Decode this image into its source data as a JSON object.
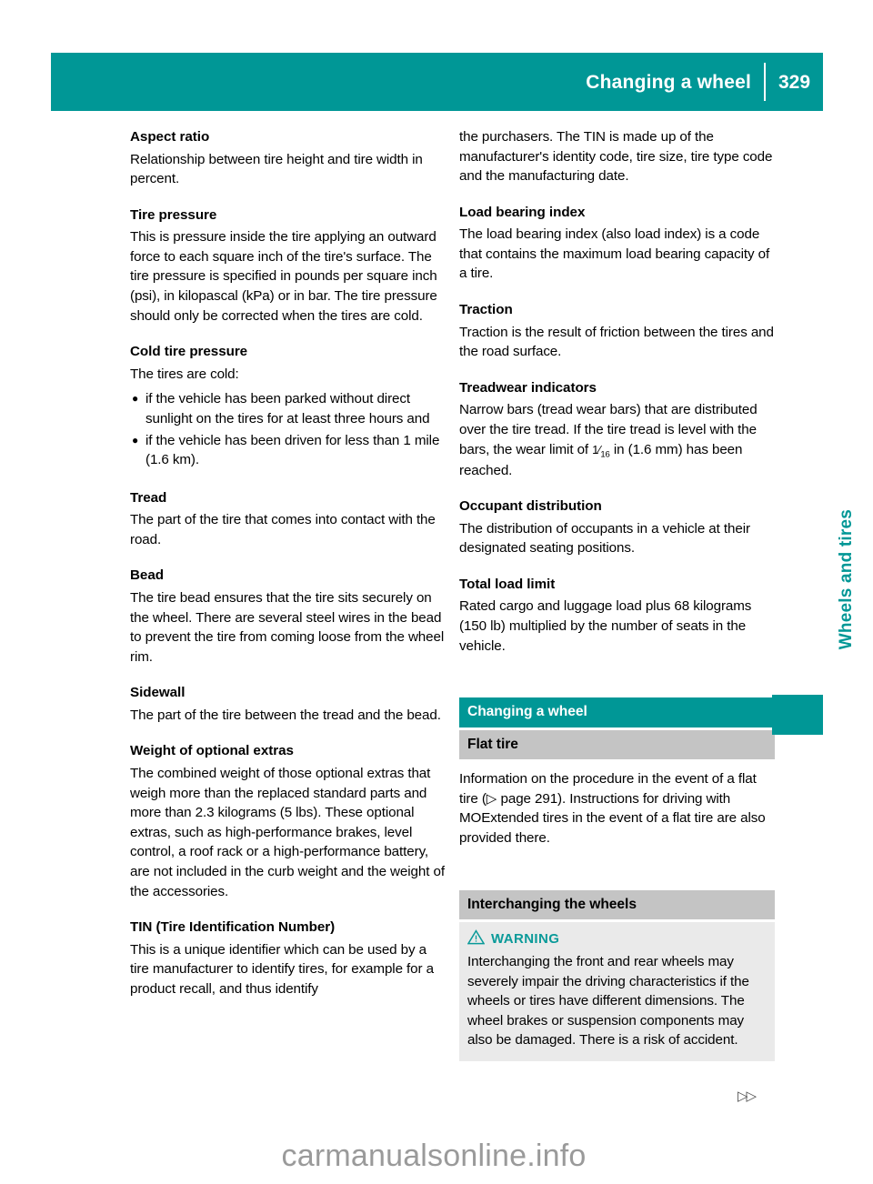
{
  "header": {
    "title": "Changing a wheel",
    "page_number": "329"
  },
  "side_tab": {
    "label": "Wheels and tires"
  },
  "footer": {
    "continue_marker": "▷▷",
    "watermark": "carmanualsonline.info"
  },
  "left_column": {
    "aspect_ratio": {
      "heading": "Aspect ratio",
      "body": "Relationship between tire height and tire width in percent."
    },
    "tire_pressure": {
      "heading": "Tire pressure",
      "body": "This is pressure inside the tire applying an outward force to each square inch of the tire's surface. The tire pressure is specified in pounds per square inch (psi), in kilopascal (kPa) or in bar. The tire pressure should only be corrected when the tires are cold."
    },
    "cold_tire_pressure": {
      "heading": "Cold tire pressure",
      "body": "The tires are cold:",
      "bullet_glyph": "●",
      "bullets": [
        "if the vehicle has been parked without direct sunlight on the tires for at least three hours and",
        "if the vehicle has been driven for less than 1 mile (1.6 km)."
      ]
    },
    "tread": {
      "heading": "Tread",
      "body": "The part of the tire that comes into contact with the road."
    },
    "bead": {
      "heading": "Bead",
      "body": "The tire bead ensures that the tire sits securely on the wheel. There are several steel wires in the bead to prevent the tire from coming loose from the wheel rim."
    },
    "sidewall": {
      "heading": "Sidewall",
      "body": "The part of the tire between the tread and the bead."
    },
    "weight_of_optional_extras": {
      "heading": "Weight of optional extras",
      "body": "The combined weight of those optional extras that weigh more than the replaced standard parts and more than 2.3 kilograms (5 lbs). These optional extras, such as high-performance brakes, level control, a roof rack or a high-performance battery, are not included in the curb weight and the weight of the accessories."
    },
    "tin": {
      "heading": "TIN (Tire Identification Number)",
      "body": "This is a unique identifier which can be used by a tire manufacturer to identify tires, for example for a product recall, and thus identify"
    }
  },
  "right_column": {
    "tin_continued": {
      "body": "the purchasers. The TIN is made up of the manufacturer's identity code, tire size, tire type code and the manufacturing date."
    },
    "load_bearing_index": {
      "heading": "Load bearing index",
      "body": "The load bearing index (also load index) is a code that contains the maximum load bearing capacity of a tire."
    },
    "traction": {
      "heading": "Traction",
      "body": "Traction is the result of friction between the tires and the road surface."
    },
    "treadwear_indicators": {
      "heading": "Treadwear indicators",
      "body_before_fraction": "Narrow bars (tread wear bars) that are distributed over the tire tread. If the tire tread is level with the bars, the wear limit of ",
      "fraction_numerator": "1",
      "fraction_denominator": "16",
      "body_after_fraction": " in (1.6 mm) has been reached."
    },
    "occupant_distribution": {
      "heading": "Occupant distribution",
      "body": "The distribution of occupants in a vehicle at their designated seating positions."
    },
    "total_load_limit": {
      "heading": "Total load limit",
      "body": "Rated cargo and luggage load plus 68 kilograms (150 lb) multiplied by the number of seats in the vehicle."
    },
    "changing_a_wheel_band": {
      "label": "Changing a wheel"
    },
    "flat_tire_band": {
      "label": "Flat tire"
    },
    "flat_tire": {
      "body_before_ref": "Information on the procedure in the event of a flat tire (",
      "ref_glyph": "▷",
      "ref_text": " page 291",
      "body_after_ref": "). Instructions for driving with MOExtended tires in the event of a flat tire are also provided there."
    },
    "interchanging_band": {
      "label": "Interchanging the wheels"
    },
    "warning": {
      "icon_name": "warning-triangle-icon",
      "title": "WARNING",
      "body": "Interchanging the front and rear wheels may severely impair the driving characteristics if the wheels or tires have different dimensions. The wheel brakes or suspension components may also be damaged. There is a risk of accident."
    }
  },
  "colors": {
    "teal": "#009796",
    "band_gray": "#c4c4c4",
    "warning_gray": "#eaeaea",
    "watermark_gray": "#9a9a9a"
  }
}
